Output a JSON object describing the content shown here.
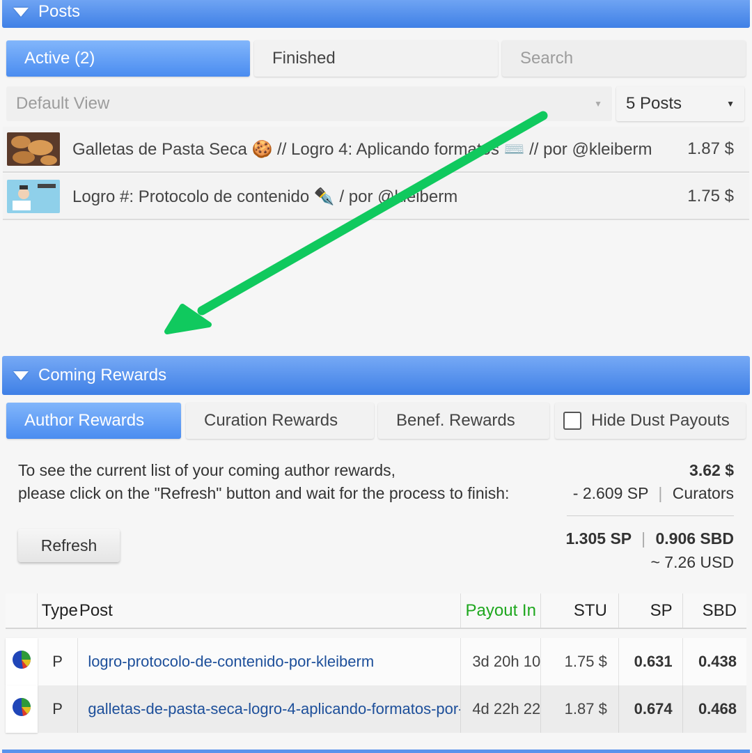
{
  "posts_section": {
    "title": "Posts",
    "tabs": {
      "active": "Active (2)",
      "finished": "Finished"
    },
    "search_placeholder": "Search",
    "view_select": "Default View",
    "count_select": "5 Posts",
    "items": [
      {
        "title": "Galletas de Pasta Seca 🍪 // Logro 4: Aplicando formatos ⌨️ // por @kleiberm",
        "amount": "1.87 $"
      },
      {
        "title": "Logro #: Protocolo de contenido ✒️ / por @kleiberm",
        "amount": "1.75 $"
      }
    ]
  },
  "rewards_section": {
    "title": "Coming Rewards",
    "tabs": {
      "author": "Author Rewards",
      "curation": "Curation Rewards",
      "benef": "Benef. Rewards",
      "hide_dust": "Hide Dust Payouts"
    },
    "info_line1": "To see the current list of your coming author rewards,",
    "info_line2": "please click on the \"Refresh\" button and wait for the process to finish:",
    "total": "3.62 $",
    "curators_sp": "- 2.609 SP",
    "sep": "|",
    "curators_label": "Curators",
    "sp_total": "1.305 SP",
    "sbd_total": "0.906 SBD",
    "usd_total": "~ 7.26 USD",
    "refresh_label": "Refresh",
    "table": {
      "headers": {
        "type": "Type",
        "post": "Post",
        "payout": "Payout In",
        "stu": "STU",
        "sp": "SP",
        "sbd": "SBD"
      },
      "rows": [
        {
          "type": "P",
          "post": "logro-protocolo-de-contenido-por-kleiberm",
          "payout": "3d 20h 10",
          "stu": "1.75 $",
          "sp": "0.631",
          "sbd": "0.438"
        },
        {
          "type": "P",
          "post": "galletas-de-pasta-seca-logro-4-aplicando-formatos-por-",
          "payout": "4d 22h 22",
          "stu": "1.87 $",
          "sp": "0.674",
          "sbd": "0.468"
        }
      ]
    }
  },
  "colors": {
    "header_blue": "#3f80e6",
    "payout_green": "#1ea71e",
    "arrow_green": "#10c95e",
    "link_blue": "#1d4f9a"
  },
  "annotation": {
    "icon": "arrow-annotation-icon"
  }
}
